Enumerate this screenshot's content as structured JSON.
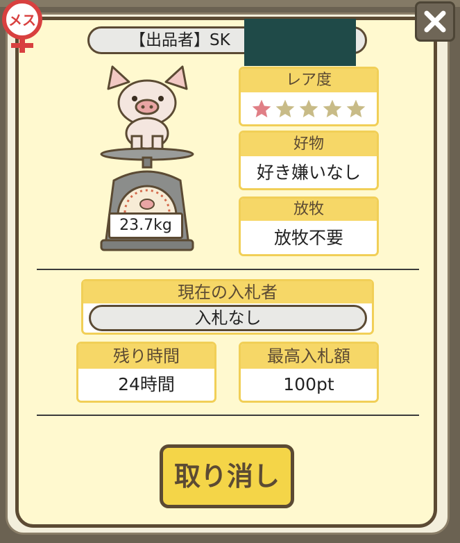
{
  "seller": {
    "label": "【出品者】SK"
  },
  "rarity": {
    "header": "レア度",
    "stars_filled": 1,
    "stars_total": 5,
    "filled_color": "#e07f86",
    "empty_color": "#c8bb87"
  },
  "favorite": {
    "header": "好物",
    "value": "好き嫌いなし"
  },
  "grazing": {
    "header": "放牧",
    "value": "放牧不要"
  },
  "weight": {
    "value": "23.7kg"
  },
  "current_bidder": {
    "header": "現在の入札者",
    "value": "入札なし"
  },
  "time_left": {
    "header": "残り時間",
    "value": "24時間"
  },
  "top_bid": {
    "header": "最高入札額",
    "value": "100pt"
  },
  "cancel_button": {
    "label": "取り消し"
  },
  "gender_badge": {
    "text": "メス",
    "color": "#d8403f"
  },
  "colors": {
    "panel": "#fff9cf",
    "accent": "#f6d767",
    "border": "#5b4a33"
  },
  "icons": {
    "close": "close-icon",
    "gender": "female-icon",
    "pig": "pig-icon",
    "scale": "scale-icon"
  }
}
